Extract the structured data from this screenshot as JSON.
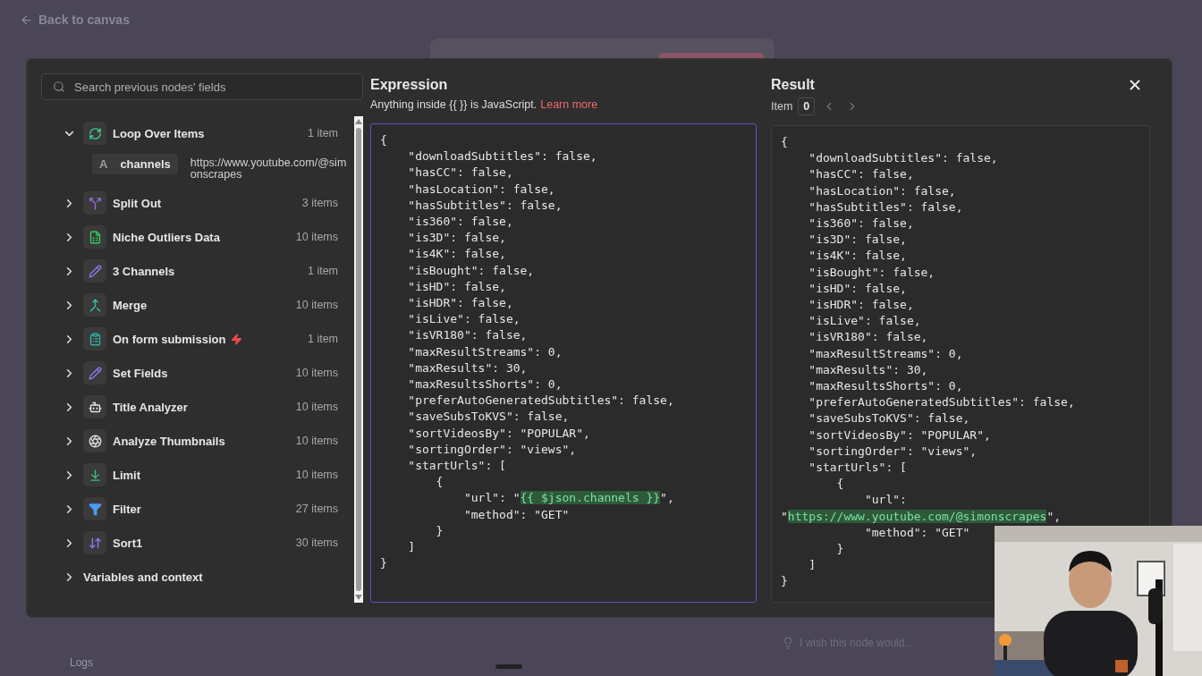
{
  "back_link": "Back to canvas",
  "search": {
    "placeholder": "Search previous nodes' fields"
  },
  "tree": [
    {
      "kind": "loop",
      "label": "Loop Over Items",
      "count": "1 item",
      "expanded": true,
      "trigger": false,
      "fields": [
        {
          "type": "A",
          "name": "channels",
          "value": "https://www.youtube.com/@simonscrapes"
        }
      ]
    },
    {
      "kind": "split",
      "label": "Split Out",
      "count": "3 items",
      "expanded": false,
      "trigger": false
    },
    {
      "kind": "sheet",
      "label": "Niche Outliers Data",
      "count": "10 items",
      "expanded": false,
      "trigger": false
    },
    {
      "kind": "edit",
      "label": "3 Channels",
      "count": "1 item",
      "expanded": false,
      "trigger": false
    },
    {
      "kind": "merge",
      "label": "Merge",
      "count": "10 items",
      "expanded": false,
      "trigger": false
    },
    {
      "kind": "form",
      "label": "On form submission",
      "count": "1 item",
      "expanded": false,
      "trigger": true
    },
    {
      "kind": "edit",
      "label": "Set Fields",
      "count": "10 items",
      "expanded": false,
      "trigger": false
    },
    {
      "kind": "robot",
      "label": "Title Analyzer",
      "count": "10 items",
      "expanded": false,
      "trigger": false
    },
    {
      "kind": "ai",
      "label": "Analyze Thumbnails",
      "count": "10 items",
      "expanded": false,
      "trigger": false
    },
    {
      "kind": "limit",
      "label": "Limit",
      "count": "10 items",
      "expanded": false,
      "trigger": false
    },
    {
      "kind": "filter",
      "label": "Filter",
      "count": "27 items",
      "expanded": false,
      "trigger": false
    },
    {
      "kind": "sort",
      "label": "Sort1",
      "count": "30 items",
      "expanded": false,
      "trigger": false
    },
    {
      "kind": "plain",
      "label": "Variables and context",
      "expanded": false,
      "trigger": false
    }
  ],
  "expression": {
    "title": "Expression",
    "hint": "Anything inside {{  }} is JavaScript.",
    "link": "Learn more",
    "lines": [
      [
        "{"
      ],
      [
        "    \"downloadSubtitles\": false,"
      ],
      [
        "    \"hasCC\": false,"
      ],
      [
        "    \"hasLocation\": false,"
      ],
      [
        "    \"hasSubtitles\": false,"
      ],
      [
        "    \"is360\": false,"
      ],
      [
        "    \"is3D\": false,"
      ],
      [
        "    \"is4K\": false,"
      ],
      [
        "    \"isBought\": false,"
      ],
      [
        "    \"isHD\": false,"
      ],
      [
        "    \"isHDR\": false,"
      ],
      [
        "    \"isLive\": false,"
      ],
      [
        "    \"isVR180\": false,"
      ],
      [
        "    \"maxResultStreams\": 0,"
      ],
      [
        "    \"maxResults\": 30,"
      ],
      [
        "    \"maxResultsShorts\": 0,"
      ],
      [
        "    \"preferAutoGeneratedSubtitles\": false,"
      ],
      [
        "    \"saveSubsToKVS\": false,"
      ],
      [
        "    \"sortVideosBy\": \"POPULAR\","
      ],
      [
        "    \"sortingOrder\": \"views\","
      ],
      [
        "    \"startUrls\": ["
      ],
      [
        "        {"
      ],
      [
        "            \"url\": \"",
        "{{ $json.channels }}",
        "\","
      ],
      [
        "            \"method\": \"GET\""
      ],
      [
        "        }"
      ],
      [
        "    ]"
      ],
      [
        "}"
      ]
    ]
  },
  "result": {
    "title": "Result",
    "item_label": "Item",
    "item_index": "0",
    "lines": [
      [
        "{"
      ],
      [
        "    \"downloadSubtitles\": false,"
      ],
      [
        "    \"hasCC\": false,"
      ],
      [
        "    \"hasLocation\": false,"
      ],
      [
        "    \"hasSubtitles\": false,"
      ],
      [
        "    \"is360\": false,"
      ],
      [
        "    \"is3D\": false,"
      ],
      [
        "    \"is4K\": false,"
      ],
      [
        "    \"isBought\": false,"
      ],
      [
        "    \"isHD\": false,"
      ],
      [
        "    \"isHDR\": false,"
      ],
      [
        "    \"isLive\": false,"
      ],
      [
        "    \"isVR180\": false,"
      ],
      [
        "    \"maxResultStreams\": 0,"
      ],
      [
        "    \"maxResults\": 30,"
      ],
      [
        "    \"maxResultsShorts\": 0,"
      ],
      [
        "    \"preferAutoGeneratedSubtitles\": false,"
      ],
      [
        "    \"saveSubsToKVS\": false,"
      ],
      [
        "    \"sortVideosBy\": \"POPULAR\","
      ],
      [
        "    \"sortingOrder\": \"views\","
      ],
      [
        "    \"startUrls\": ["
      ],
      [
        "        {"
      ],
      [
        "            \"url\":"
      ],
      [
        "\"",
        "https://www.youtube.com/@simonscrapes",
        "\","
      ],
      [
        "            \"method\": \"GET\""
      ],
      [
        "        }"
      ],
      [
        "    ]"
      ],
      [
        "}"
      ]
    ]
  },
  "footer": {
    "prompt": "I wish this node would...",
    "logs": "Logs"
  }
}
